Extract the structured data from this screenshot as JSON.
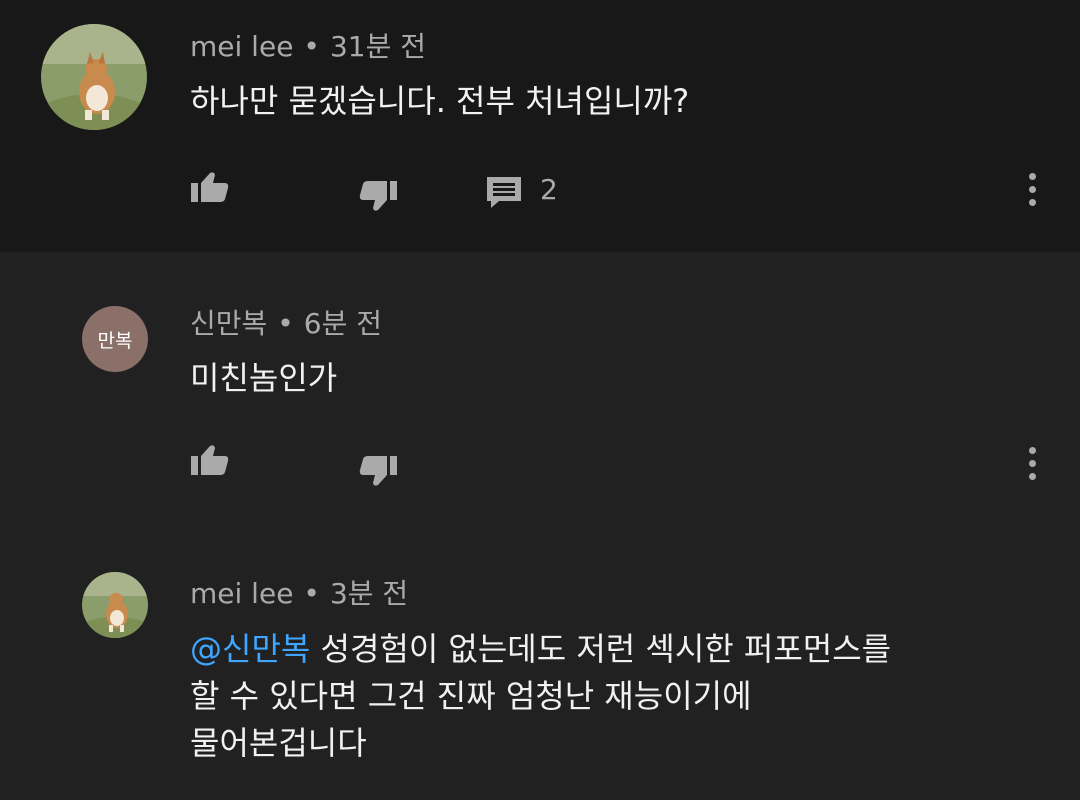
{
  "comments": [
    {
      "author": "mei lee",
      "separator": "•",
      "time": "31분 전",
      "text": "하나만 묻겠습니다. 전부 처녀입니까?",
      "reply_count": "2",
      "avatar_icon": "dog-photo-avatar"
    },
    {
      "author": "신만복",
      "separator": "•",
      "time": "6분 전",
      "avatar_initials": "만복",
      "avatar_color": "#8a7069",
      "text": "미친놈인가"
    },
    {
      "author": "mei lee",
      "separator": "•",
      "time": "3분 전",
      "mention": "@신만복",
      "text_line1": " 성경험이 없는데도 저런 섹시한 퍼포먼스를",
      "text_line2": "할 수 있다면 그건 진짜 엄청난 재능이기에",
      "text_line3": "물어본겁니다",
      "avatar_icon": "dog-photo-avatar"
    }
  ],
  "colors": {
    "background": "#212121",
    "highlight_background": "#181818",
    "text": "#f1f1f1",
    "secondary_text": "#aaaaaa",
    "mention": "#3ea6ff"
  }
}
